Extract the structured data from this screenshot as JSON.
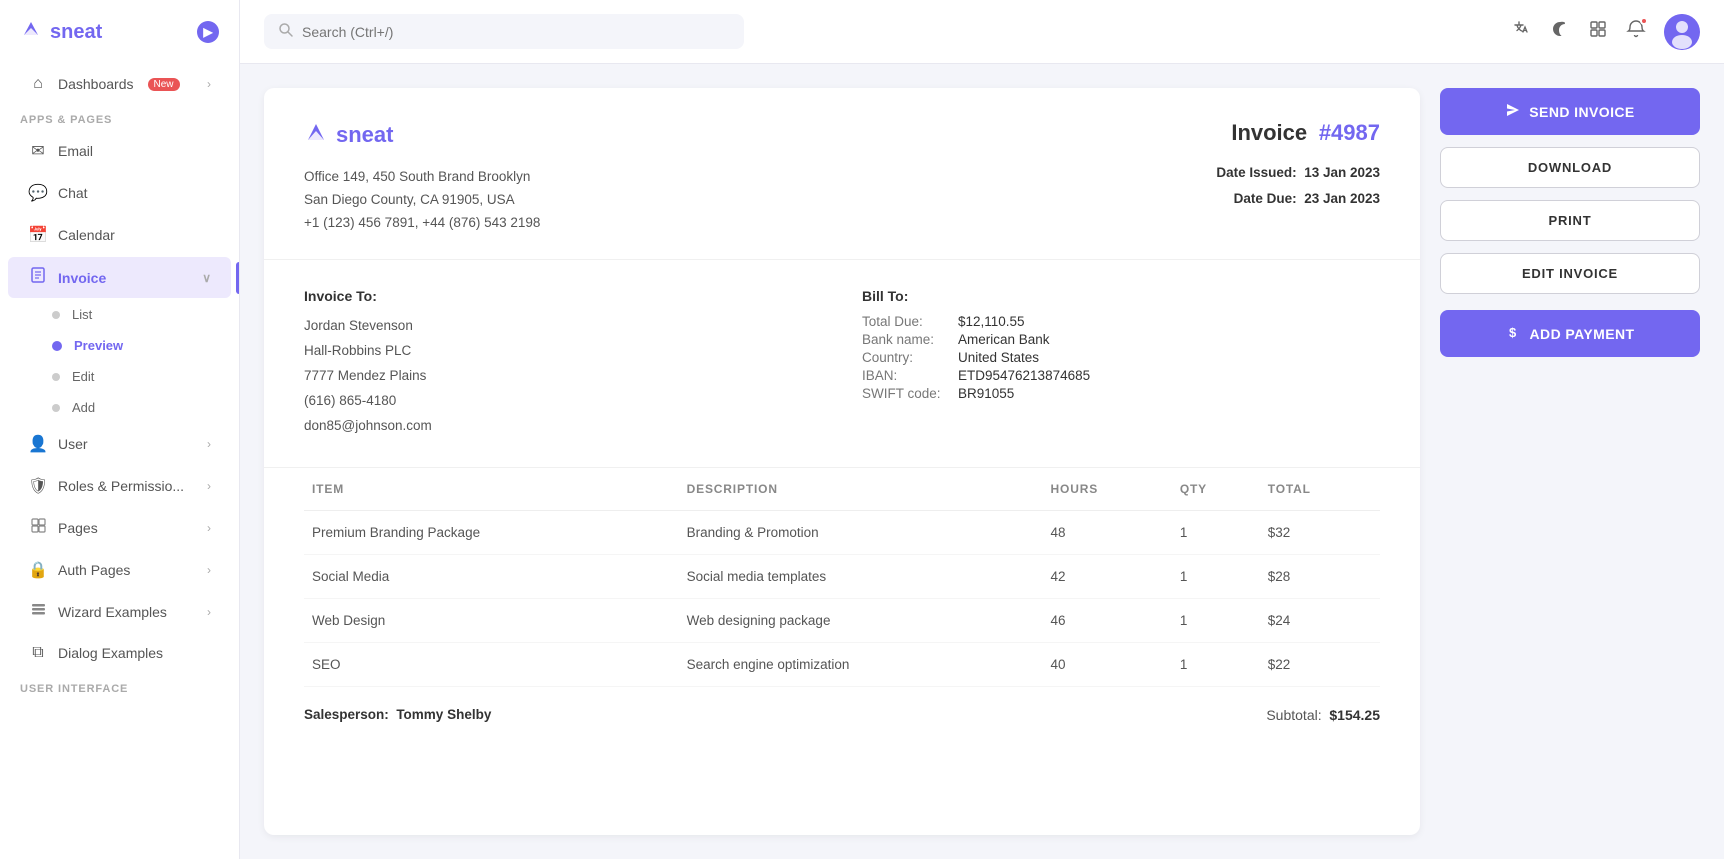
{
  "app": {
    "name": "sneat",
    "logo_icon": "S"
  },
  "topbar": {
    "search_placeholder": "Search (Ctrl+/)"
  },
  "sidebar": {
    "section_apps": "APPS & PAGES",
    "section_ui": "USER INTERFACE",
    "items": [
      {
        "id": "dashboards",
        "label": "Dashboards",
        "icon": "⌂",
        "badge": "New",
        "has_arrow": true
      },
      {
        "id": "email",
        "label": "Email",
        "icon": "✉"
      },
      {
        "id": "chat",
        "label": "Chat",
        "icon": "💬"
      },
      {
        "id": "calendar",
        "label": "Calendar",
        "icon": "📅"
      },
      {
        "id": "invoice",
        "label": "Invoice",
        "icon": "📋",
        "active": true,
        "has_arrow": true
      }
    ],
    "invoice_sub": [
      {
        "id": "list",
        "label": "List"
      },
      {
        "id": "preview",
        "label": "Preview",
        "active": true
      },
      {
        "id": "edit",
        "label": "Edit"
      },
      {
        "id": "add",
        "label": "Add"
      }
    ],
    "items2": [
      {
        "id": "user",
        "label": "User",
        "icon": "👤",
        "has_arrow": true
      },
      {
        "id": "roles",
        "label": "Roles & Permissio...",
        "icon": "🛡",
        "has_arrow": true
      },
      {
        "id": "pages",
        "label": "Pages",
        "icon": "📄",
        "has_arrow": true
      },
      {
        "id": "auth",
        "label": "Auth Pages",
        "icon": "🔒",
        "has_arrow": true
      },
      {
        "id": "wizard",
        "label": "Wizard Examples",
        "icon": "☰",
        "has_arrow": true
      },
      {
        "id": "dialog",
        "label": "Dialog Examples",
        "icon": "⧉"
      }
    ]
  },
  "invoice": {
    "brand": "sneat",
    "address_line1": "Office 149, 450 South Brand Brooklyn",
    "address_line2": "San Diego County, CA 91905, USA",
    "address_line3": "+1 (123) 456 7891, +44 (876) 543 2198",
    "title": "Invoice",
    "number": "#4987",
    "date_issued_label": "Date Issued:",
    "date_issued_value": "13 Jan 2023",
    "date_due_label": "Date Due:",
    "date_due_value": "23 Jan 2023",
    "invoice_to_label": "Invoice To:",
    "invoice_to_name": "Jordan Stevenson",
    "invoice_to_company": "Hall-Robbins PLC",
    "invoice_to_address": "7777 Mendez Plains",
    "invoice_to_phone": "(616) 865-4180",
    "invoice_to_email": "don85@johnson.com",
    "bill_to_label": "Bill To:",
    "bill_total_due_label": "Total Due:",
    "bill_total_due_value": "$12,110.55",
    "bill_bank_label": "Bank name:",
    "bill_bank_value": "American Bank",
    "bill_country_label": "Country:",
    "bill_country_value": "United States",
    "bill_iban_label": "IBAN:",
    "bill_iban_value": "ETD95476213874685",
    "bill_swift_label": "SWIFT code:",
    "bill_swift_value": "BR91055",
    "table_headers": [
      "ITEM",
      "DESCRIPTION",
      "HOURS",
      "QTY",
      "TOTAL"
    ],
    "table_rows": [
      {
        "item": "Premium Branding Package",
        "description": "Branding & Promotion",
        "hours": "48",
        "qty": "1",
        "total": "$32"
      },
      {
        "item": "Social Media",
        "description": "Social media templates",
        "hours": "42",
        "qty": "1",
        "total": "$28"
      },
      {
        "item": "Web Design",
        "description": "Web designing package",
        "hours": "46",
        "qty": "1",
        "total": "$24"
      },
      {
        "item": "SEO",
        "description": "Search engine optimization",
        "hours": "40",
        "qty": "1",
        "total": "$22"
      }
    ],
    "salesperson_label": "Salesperson:",
    "salesperson_name": "Tommy Shelby",
    "subtotal_label": "Subtotal:",
    "subtotal_value": "$154.25"
  },
  "actions": {
    "send_invoice": "SEND INVOICE",
    "download": "DOWNLOAD",
    "print": "PRINT",
    "edit_invoice": "EDIT INVOICE",
    "add_payment": "ADD PAYMENT"
  }
}
